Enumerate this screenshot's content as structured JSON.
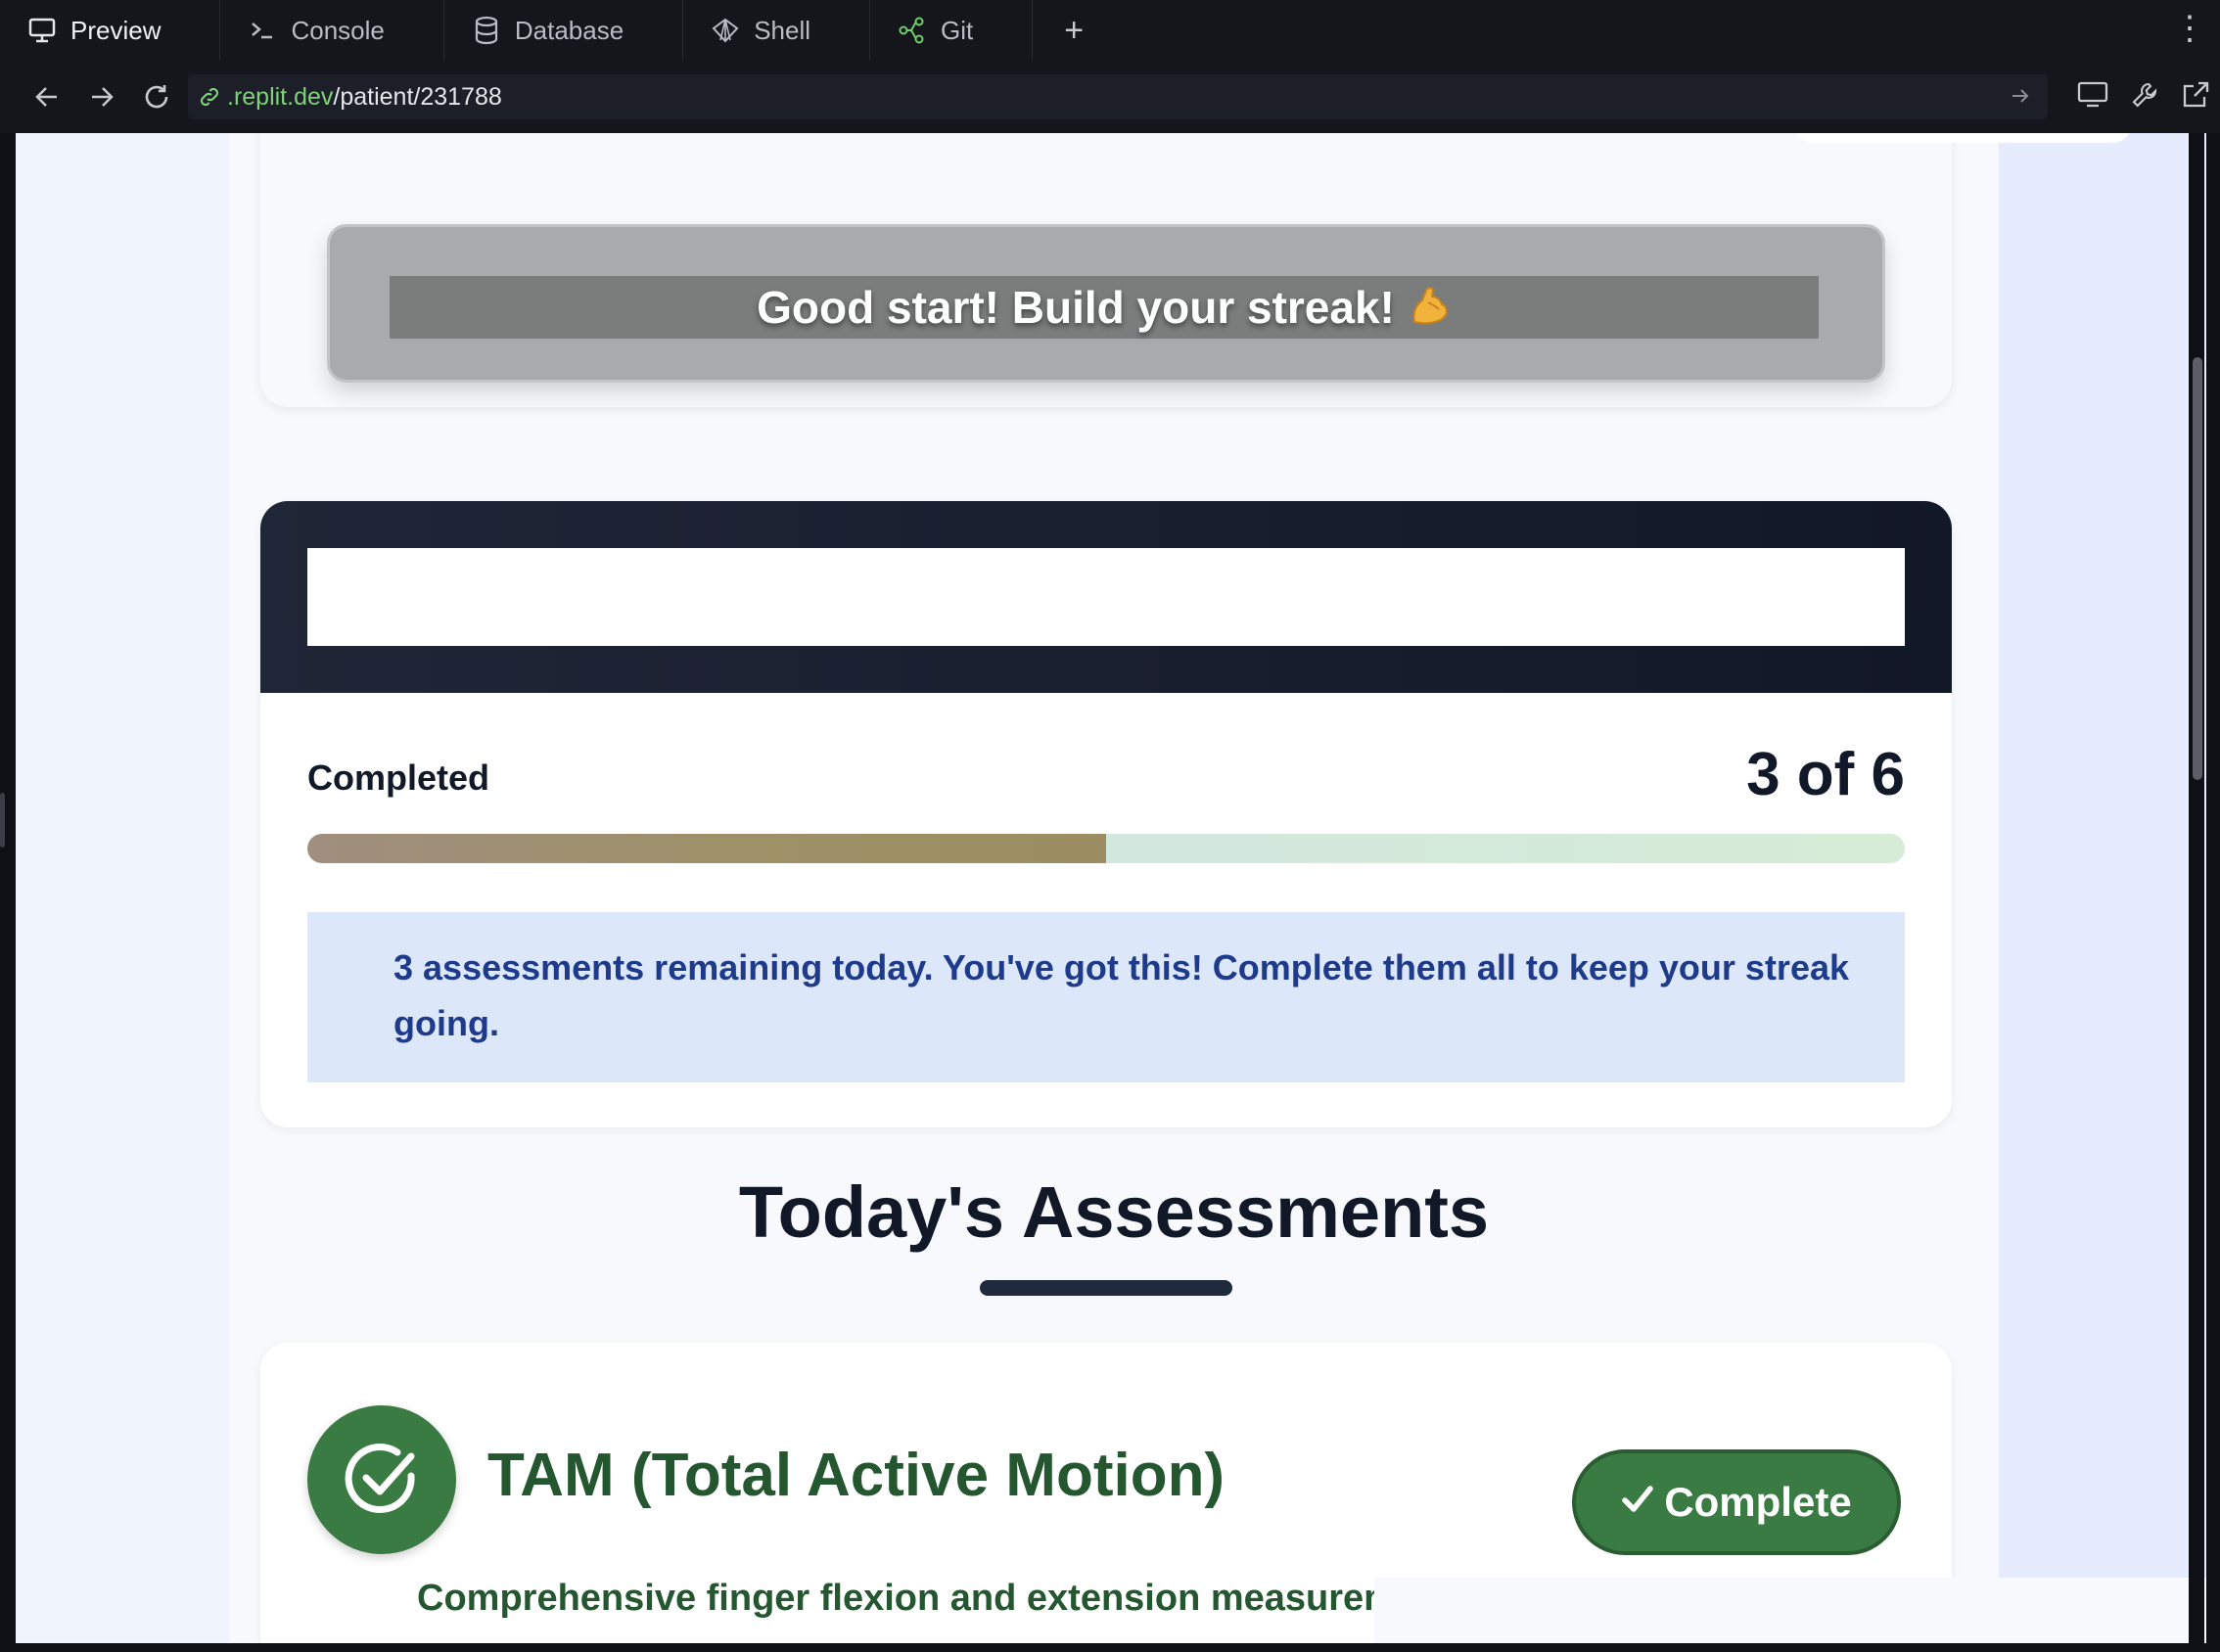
{
  "tabs": [
    {
      "label": "Preview",
      "icon": "monitor-icon",
      "active": true
    },
    {
      "label": "Console",
      "icon": "terminal-icon",
      "active": false
    },
    {
      "label": "Database",
      "icon": "database-icon",
      "active": false
    },
    {
      "label": "Shell",
      "icon": "shell-icon",
      "active": false
    },
    {
      "label": "Git",
      "icon": "git-icon",
      "active": false
    }
  ],
  "address": {
    "domain": ".replit.dev",
    "path": "/patient/231788"
  },
  "motivation": {
    "text": "Good start! Build your streak!",
    "emoji_icon": "flexed-biceps-icon"
  },
  "progress": {
    "label": "Completed",
    "count_text": "3 of 6",
    "completed": 3,
    "total": 6,
    "fraction": 0.5,
    "message": "3 assessments remaining today. You've got this! Complete them all to keep your streak going."
  },
  "assessments_section": {
    "title": "Today's Assessments",
    "items": [
      {
        "title": "TAM (Total Active Motion)",
        "status_label": "Complete",
        "description": "Comprehensive finger flexion and extension measuremer"
      }
    ]
  },
  "colors": {
    "accent_green": "#3a7a43",
    "dark_navy": "#111827",
    "info_blue": "#1e3a8a"
  }
}
